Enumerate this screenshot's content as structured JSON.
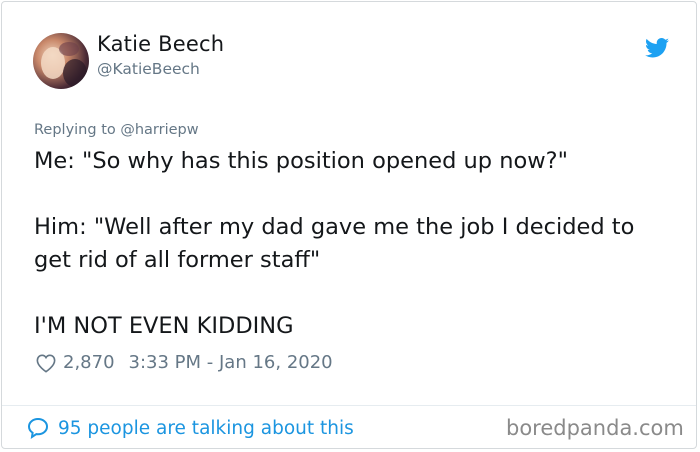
{
  "user": {
    "display_name": "Katie Beech",
    "handle": "@KatieBeech"
  },
  "reply": {
    "prefix": "Replying to",
    "mention": "@harriepw"
  },
  "tweet": {
    "line1": "Me: \"So why has this position opened up now?\"",
    "line2": "Him: \"Well after my dad gave me the job I decided to get rid of all former staff\"",
    "line3": "I'M NOT EVEN KIDDING"
  },
  "meta": {
    "likes": "2,870",
    "timestamp": "3:33 PM - Jan 16, 2020"
  },
  "footer": {
    "talking": "95 people are talking about this"
  },
  "watermark": "boredpanda.com",
  "colors": {
    "twitter_blue": "#1da1f2",
    "link_blue": "#1b95e0",
    "secondary_text": "#657786",
    "primary_text": "#14171a"
  },
  "icons": {
    "brand": "twitter-bird-icon",
    "like": "heart-icon",
    "reply": "speech-bubble-icon"
  }
}
